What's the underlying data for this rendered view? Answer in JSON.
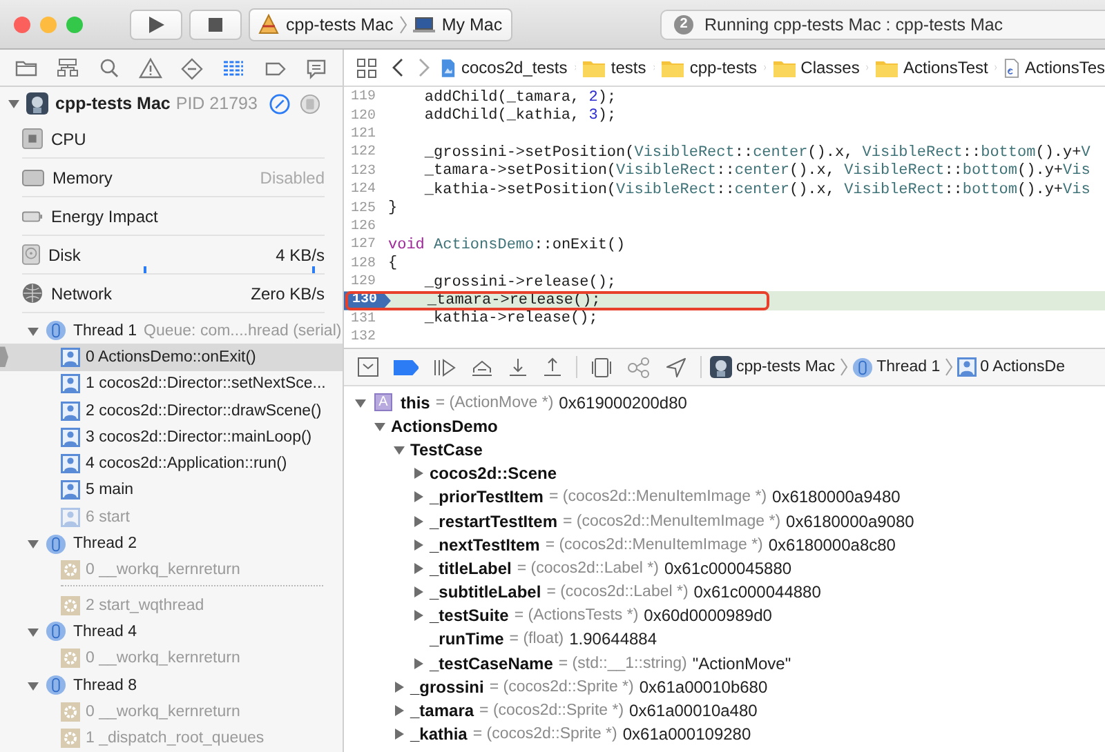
{
  "toolbar": {
    "scheme": {
      "target": "cpp-tests Mac",
      "destination": "My Mac"
    },
    "status": {
      "badge": "2",
      "text": "Running cpp-tests Mac : cpp-tests Mac"
    }
  },
  "navigator_tabs": [
    {
      "kind": "folder",
      "selected": false
    },
    {
      "kind": "hierarchy",
      "selected": false
    },
    {
      "kind": "search",
      "selected": false
    },
    {
      "kind": "warning",
      "selected": false
    },
    {
      "kind": "test",
      "selected": false
    },
    {
      "kind": "debug",
      "selected": true
    },
    {
      "kind": "breakpoint",
      "selected": false
    },
    {
      "kind": "report",
      "selected": false
    }
  ],
  "process": {
    "name": "cpp-tests Mac",
    "pid": "PID 21793",
    "expanded": true
  },
  "gauges": [
    {
      "kind": "cpu",
      "label": "CPU"
    },
    {
      "kind": "memory",
      "label": "Memory",
      "reading": "Disabled",
      "reading_dimmed": true
    },
    {
      "kind": "energy",
      "label": "Energy Impact"
    },
    {
      "kind": "disk",
      "label": "Disk",
      "reading": "4 KB/s",
      "reading_dimmed": false
    },
    {
      "kind": "network",
      "label": "Network",
      "reading": "Zero KB/s",
      "reading_dimmed": false
    }
  ],
  "threads": [
    {
      "name": "Thread 1",
      "queue": "Queue: com....hread (serial)",
      "expanded": true,
      "frames": [
        {
          "text": "0 ActionsDemo::onExit()",
          "kind": "user",
          "dimmed": false,
          "selected": true,
          "gap_before": false
        },
        {
          "text": "1 cocos2d::Director::setNextSce...",
          "kind": "user",
          "dimmed": false,
          "selected": false,
          "gap_before": false
        },
        {
          "text": "2 cocos2d::Director::drawScene()",
          "kind": "user",
          "dimmed": false,
          "selected": false,
          "gap_before": false
        },
        {
          "text": "3 cocos2d::Director::mainLoop()",
          "kind": "user",
          "dimmed": false,
          "selected": false,
          "gap_before": false
        },
        {
          "text": "4 cocos2d::Application::run()",
          "kind": "user",
          "dimmed": false,
          "selected": false,
          "gap_before": false
        },
        {
          "text": "5 main",
          "kind": "user",
          "dimmed": false,
          "selected": false,
          "gap_before": false
        },
        {
          "text": "6 start",
          "kind": "user",
          "dimmed": true,
          "selected": false,
          "gap_before": false
        }
      ]
    },
    {
      "name": "Thread 2",
      "expanded": true,
      "frames": [
        {
          "text": "0 __workq_kernreturn",
          "kind": "system",
          "dimmed": true,
          "selected": false,
          "gap_before": false
        },
        {
          "text": "2 start_wqthread",
          "kind": "system",
          "dimmed": true,
          "selected": false,
          "gap_before": true
        }
      ]
    },
    {
      "name": "Thread 4",
      "expanded": true,
      "frames": [
        {
          "text": "0 __workq_kernreturn",
          "kind": "system",
          "dimmed": true,
          "selected": false,
          "gap_before": false
        }
      ]
    },
    {
      "name": "Thread 8",
      "expanded": true,
      "frames": [
        {
          "text": "0 __workq_kernreturn",
          "kind": "system",
          "dimmed": true,
          "selected": false,
          "gap_before": false
        },
        {
          "text": "1 _dispatch_root_queues",
          "kind": "system",
          "dimmed": true,
          "selected": false,
          "gap_before": false
        }
      ]
    }
  ],
  "jump_bar": [
    {
      "kind": "project",
      "label": "cocos2d_tests"
    },
    {
      "kind": "folder",
      "label": "tests"
    },
    {
      "kind": "folder",
      "label": "cpp-tests"
    },
    {
      "kind": "folder",
      "label": "Classes"
    },
    {
      "kind": "folder",
      "label": "ActionsTest"
    },
    {
      "kind": "file",
      "label": "ActionsTes"
    }
  ],
  "code": {
    "lines": [
      {
        "number": "119",
        "current": false,
        "outlined": false,
        "tokens": [
          {
            "text": "    addChild(_tamara, ",
            "kind": "plain"
          },
          {
            "text": "2",
            "kind": "number"
          },
          {
            "text": ");",
            "kind": "plain"
          }
        ]
      },
      {
        "number": "120",
        "current": false,
        "outlined": false,
        "tokens": [
          {
            "text": "    addChild(_kathia, ",
            "kind": "plain"
          },
          {
            "text": "3",
            "kind": "number"
          },
          {
            "text": ");",
            "kind": "plain"
          }
        ]
      },
      {
        "number": "121",
        "current": false,
        "outlined": false
      },
      {
        "number": "122",
        "current": false,
        "outlined": false,
        "tokens": [
          {
            "text": "    _grossini->setPosition(",
            "kind": "plain"
          },
          {
            "text": "VisibleRect",
            "kind": "project"
          },
          {
            "text": "::",
            "kind": "plain"
          },
          {
            "text": "center",
            "kind": "project"
          },
          {
            "text": "().x, ",
            "kind": "plain"
          },
          {
            "text": "VisibleRect",
            "kind": "project"
          },
          {
            "text": "::",
            "kind": "plain"
          },
          {
            "text": "bottom",
            "kind": "project"
          },
          {
            "text": "().y+",
            "kind": "plain"
          },
          {
            "text": "V",
            "kind": "project"
          }
        ]
      },
      {
        "number": "123",
        "current": false,
        "outlined": false,
        "tokens": [
          {
            "text": "    _tamara->setPosition(",
            "kind": "plain"
          },
          {
            "text": "VisibleRect",
            "kind": "project"
          },
          {
            "text": "::",
            "kind": "plain"
          },
          {
            "text": "center",
            "kind": "project"
          },
          {
            "text": "().x, ",
            "kind": "plain"
          },
          {
            "text": "VisibleRect",
            "kind": "project"
          },
          {
            "text": "::",
            "kind": "plain"
          },
          {
            "text": "bottom",
            "kind": "project"
          },
          {
            "text": "().y+",
            "kind": "plain"
          },
          {
            "text": "Vis",
            "kind": "project"
          }
        ]
      },
      {
        "number": "124",
        "current": false,
        "outlined": false,
        "tokens": [
          {
            "text": "    _kathia->setPosition(",
            "kind": "plain"
          },
          {
            "text": "VisibleRect",
            "kind": "project"
          },
          {
            "text": "::",
            "kind": "plain"
          },
          {
            "text": "center",
            "kind": "project"
          },
          {
            "text": "().x, ",
            "kind": "plain"
          },
          {
            "text": "VisibleRect",
            "kind": "project"
          },
          {
            "text": "::",
            "kind": "plain"
          },
          {
            "text": "bottom",
            "kind": "project"
          },
          {
            "text": "().y+",
            "kind": "plain"
          },
          {
            "text": "Vis",
            "kind": "project"
          }
        ]
      },
      {
        "number": "125",
        "current": false,
        "outlined": false,
        "tokens": [
          {
            "text": "}",
            "kind": "plain"
          }
        ]
      },
      {
        "number": "126",
        "current": false,
        "outlined": false
      },
      {
        "number": "127",
        "current": false,
        "outlined": false,
        "tokens": [
          {
            "text": "void ",
            "kind": "keyword"
          },
          {
            "text": "ActionsDemo",
            "kind": "project"
          },
          {
            "text": "::onExit()",
            "kind": "plain"
          }
        ]
      },
      {
        "number": "128",
        "current": false,
        "outlined": false,
        "tokens": [
          {
            "text": "{",
            "kind": "plain"
          }
        ]
      },
      {
        "number": "129",
        "current": false,
        "outlined": false,
        "tokens": [
          {
            "text": "    _grossini->release();",
            "kind": "plain"
          }
        ]
      },
      {
        "number": "130",
        "current": true,
        "outlined": true,
        "tokens": [
          {
            "text": "    _tamara->release();",
            "kind": "plain"
          }
        ]
      },
      {
        "number": "131",
        "current": false,
        "outlined": false,
        "tokens": [
          {
            "text": "    _kathia->release();",
            "kind": "plain"
          }
        ]
      },
      {
        "number": "132",
        "current": false,
        "outlined": false
      }
    ]
  },
  "debug_bar": {
    "breakpoints_active": true,
    "crumbs": [
      {
        "kind": "app",
        "label": "cpp-tests Mac"
      },
      {
        "kind": "thread",
        "label": "Thread 1"
      },
      {
        "kind": "frame",
        "label": "0 ActionsDe"
      }
    ]
  },
  "variables": [
    {
      "name": "this",
      "icon_letter": "A",
      "type": "= (ActionMove *)",
      "value": "0x619000200d80",
      "expanded": true,
      "children": [
        {
          "name": "ActionsDemo",
          "expanded": true,
          "children": [
            {
              "name": "TestCase",
              "expanded": true,
              "children": [
                {
                  "name": "cocos2d::Scene",
                  "expanded": false
                },
                {
                  "name": "_priorTestItem",
                  "type": "= (cocos2d::MenuItemImage *)",
                  "value": "0x6180000a9480",
                  "expanded": false
                },
                {
                  "name": "_restartTestItem",
                  "type": "= (cocos2d::MenuItemImage *)",
                  "value": "0x6180000a9080",
                  "expanded": false
                },
                {
                  "name": "_nextTestItem",
                  "type": "= (cocos2d::MenuItemImage *)",
                  "value": "0x6180000a8c80",
                  "expanded": false
                },
                {
                  "name": "_titleLabel",
                  "type": "= (cocos2d::Label *)",
                  "value": "0x61c000045880",
                  "expanded": false
                },
                {
                  "name": "_subtitleLabel",
                  "type": "= (cocos2d::Label *)",
                  "value": "0x61c000044880",
                  "expanded": false
                },
                {
                  "name": "_testSuite",
                  "type": "= (ActionsTests *)",
                  "value": "0x60d0000989d0",
                  "expanded": false
                },
                {
                  "name": "_runTime",
                  "type": "= (float)",
                  "value": "1.90644884"
                },
                {
                  "name": "_testCaseName",
                  "type": "= (std::__1::string)",
                  "value": "\"ActionMove\"",
                  "expanded": false
                }
              ]
            },
            {
              "name": "_grossini",
              "type": "= (cocos2d::Sprite *)",
              "value": "0x61a00010b680",
              "expanded": false
            },
            {
              "name": "_tamara",
              "type": "= (cocos2d::Sprite *)",
              "value": "0x61a00010a480",
              "expanded": false
            },
            {
              "name": "_kathia",
              "type": "= (cocos2d::Sprite *)",
              "value": "0x61a000109280",
              "expanded": false
            }
          ]
        }
      ]
    }
  ]
}
